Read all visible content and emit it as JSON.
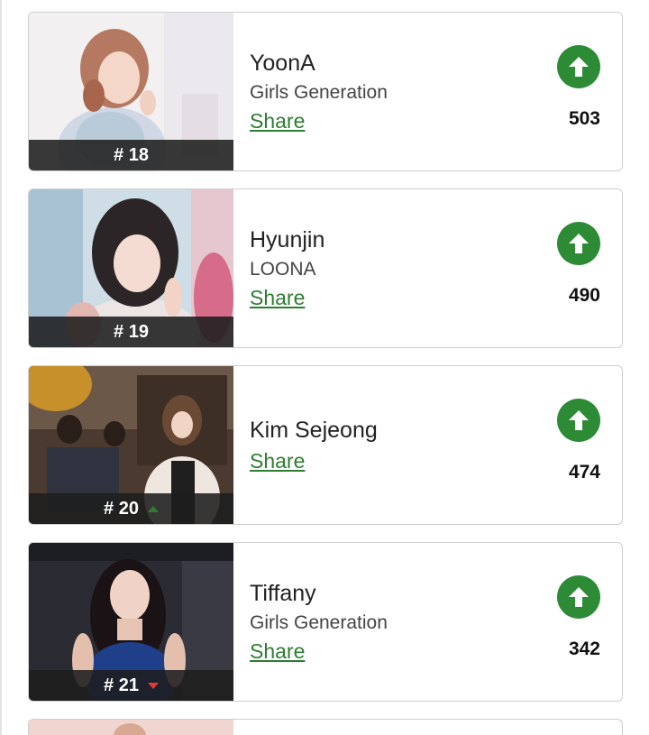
{
  "colors": {
    "accent_green": "#2e8b35",
    "link_green": "#2e7d32",
    "trend_down_red": "#e53935"
  },
  "cards": [
    {
      "rank": "# 18",
      "name": "YoonA",
      "group": "Girls Generation",
      "share": "Share",
      "votes": "503",
      "trend": "none",
      "vote_icon": "arrow-up-icon"
    },
    {
      "rank": "# 19",
      "name": "Hyunjin",
      "group": "LOONA",
      "share": "Share",
      "votes": "490",
      "trend": "none",
      "vote_icon": "arrow-up-icon"
    },
    {
      "rank": "# 20",
      "name": "Kim Sejeong",
      "group": "",
      "share": "Share",
      "votes": "474",
      "trend": "up",
      "vote_icon": "arrow-up-icon"
    },
    {
      "rank": "# 21",
      "name": "Tiffany",
      "group": "Girls Generation",
      "share": "Share",
      "votes": "342",
      "trend": "down",
      "vote_icon": "arrow-up-icon"
    }
  ]
}
